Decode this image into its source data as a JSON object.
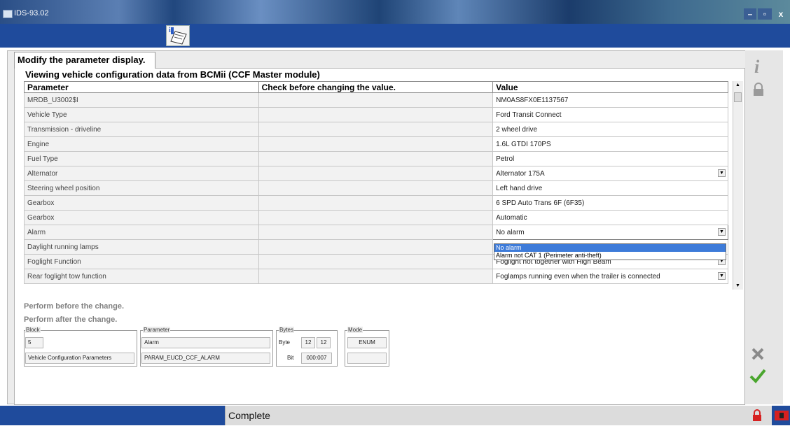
{
  "window": {
    "title": "IDS-93.02",
    "min": "–",
    "max": "▫",
    "close": "x"
  },
  "tab": {
    "label": "Modify the parameter display."
  },
  "heading": "Viewing vehicle configuration data from BCMii (CCF Master module)",
  "table": {
    "columns": [
      "Parameter",
      "Check before changing the value.",
      "Value"
    ],
    "rows": [
      {
        "parameter": "MRDB_U3002$I",
        "check": "",
        "value": "NM0AS8FX0E1137567",
        "dropdown": false
      },
      {
        "parameter": "Vehicle Type",
        "check": "",
        "value": "Ford Transit Connect",
        "dropdown": false
      },
      {
        "parameter": "Transmission - driveline",
        "check": "",
        "value": "2 wheel drive",
        "dropdown": false
      },
      {
        "parameter": "Engine",
        "check": "",
        "value": "1.6L GTDI 170PS",
        "dropdown": false
      },
      {
        "parameter": "Fuel Type",
        "check": "",
        "value": "Petrol",
        "dropdown": false
      },
      {
        "parameter": "Alternator",
        "check": "",
        "value": "Alternator 175A",
        "dropdown": true
      },
      {
        "parameter": "Steering wheel position",
        "check": "",
        "value": "Left hand drive",
        "dropdown": false
      },
      {
        "parameter": "Gearbox",
        "check": "",
        "value": "6 SPD Auto Trans 6F (6F35)",
        "dropdown": false
      },
      {
        "parameter": "Gearbox",
        "check": "",
        "value": "Automatic",
        "dropdown": false
      },
      {
        "parameter": "Alarm",
        "check": "",
        "value": "No alarm",
        "dropdown": true
      },
      {
        "parameter": "Daylight running lamps",
        "check": "",
        "value": "",
        "dropdown": false
      },
      {
        "parameter": "Foglight Function",
        "check": "",
        "value": "Foglight not together with High Beam",
        "dropdown": true
      },
      {
        "parameter": "Rear foglight tow function",
        "check": "",
        "value": "Foglamps running even when the trailer is connected",
        "dropdown": true
      }
    ]
  },
  "dropdown_list": {
    "options": [
      "No alarm",
      "Alarm not CAT 1 (Perimeter anti-theft)"
    ],
    "highlighted": "No alarm"
  },
  "perform_before": "Perform before the change.",
  "perform_after": "Perform after the change.",
  "details": {
    "block": {
      "label": "Block",
      "number": "5",
      "name": "Vehicle Configuration Parameters"
    },
    "parameter": {
      "label": "Parameter",
      "name": "Alarm",
      "id": "PARAM_EUCD_CCF_ALARM"
    },
    "bytes": {
      "label": "Bytes",
      "byte_label": "Byte",
      "byte_from": "12",
      "byte_to": "12",
      "bit_label": "Bit",
      "bit_value": "000:007"
    },
    "mode": {
      "label": "Mode",
      "value": "ENUM"
    }
  },
  "status": {
    "text": "Complete"
  },
  "icons": {
    "info": "info-icon",
    "lock": "lock-icon",
    "cancel": "cancel-icon",
    "confirm": "check-icon"
  },
  "colors": {
    "toolbar": "#1f4b9c",
    "confirm": "#4aa62e",
    "cancel": "#8a8a8a",
    "alert": "#d62020",
    "highlight": "#3d7bd9"
  }
}
